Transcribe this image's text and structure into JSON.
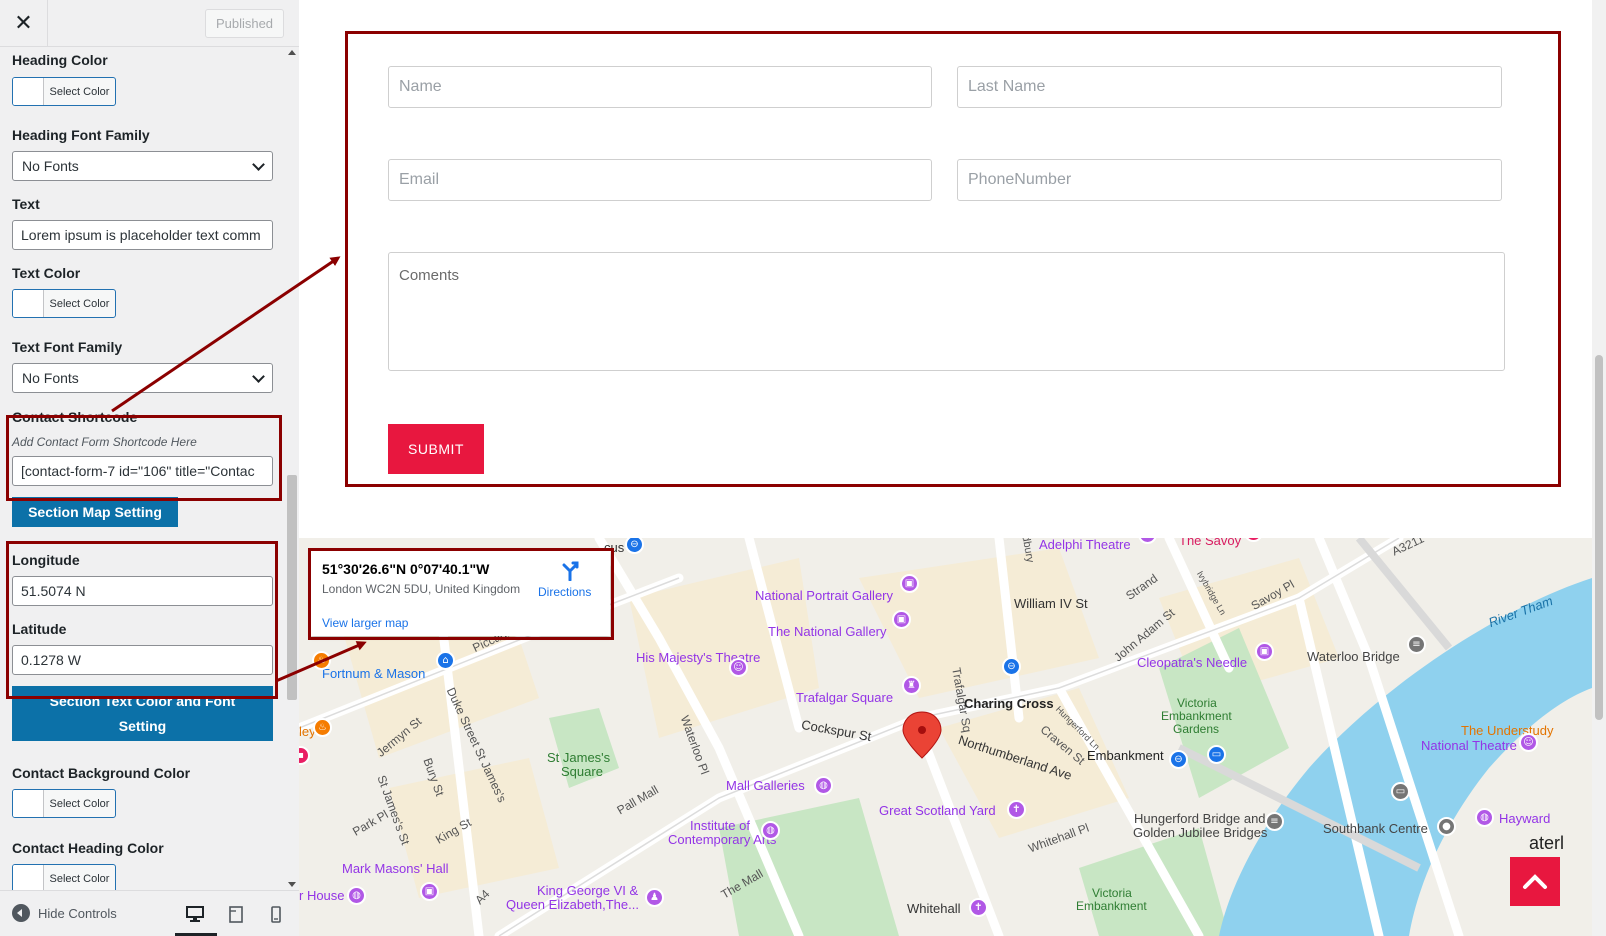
{
  "header": {
    "close_glyph": "✕",
    "published_label": "Published"
  },
  "sidebar": {
    "heading_color_label": "Heading Color",
    "heading_font_label": "Heading Font Family",
    "heading_font_value": "No Fonts",
    "text_label": "Text",
    "text_value": "Lorem ipsum is placeholder text comm",
    "text_color_label": "Text Color",
    "text_font_label": "Text Font Family",
    "text_font_value": "No Fonts",
    "contact_shortcode_label": "Contact Shortcode",
    "contact_shortcode_desc": "Add Contact Form Shortcode Here",
    "contact_shortcode_value": "[contact-form-7 id=\"106\" title=\"Contac",
    "map_section_button": "Section Map Setting",
    "longitude_label": "Longitude",
    "longitude_value": "51.5074 N",
    "latitude_label": "Latitude",
    "latitude_value": "0.1278 W",
    "text_color_font_button_line1": "Section Text Color and Font",
    "text_color_font_button_line2": "Setting",
    "contact_bg_label": "Contact Background Color",
    "contact_heading_color_label": "Contact Heading Color",
    "select_color_label": "Select Color"
  },
  "footer": {
    "hide_controls_label": "Hide Controls"
  },
  "form": {
    "name_placeholder": "Name",
    "lastname_placeholder": "Last Name",
    "email_placeholder": "Email",
    "phone_placeholder": "PhoneNumber",
    "comments_placeholder": "Coments",
    "submit_label": "SUBMIT"
  },
  "map": {
    "info_title": "51°30'26.6\"N 0°07'40.1\"W",
    "info_address": "London WC2N 5DU, United Kingdom",
    "info_directions": "Directions",
    "info_larger_map": "View larger map",
    "labels": {
      "cus": "cus",
      "adelphi": "Adelphi Theatre",
      "savoy": "The Savoy",
      "a3211": "A3211",
      "dbury": "dbury",
      "william": "William IV St",
      "strand": "Strand",
      "savoypl": "Savoy Pl",
      "ivybridge": "Ivybridge Ln",
      "river": "River Tham",
      "npg": "National Portrait Gallery",
      "tng": "The National Gallery",
      "johnadam": "John Adam St",
      "waterloo": "Waterloo Bridge",
      "piccadilly": "Piccadilly",
      "fortnum": "Fortnum & Mason",
      "hismajesty": "His Majesty's Theatre",
      "cleopatra": "Cleopatra's Needle",
      "trafalgar": "Trafalgar Square",
      "charing": "Charing Cross",
      "victoria_gardens_1": "Victoria",
      "victoria_gardens_2": "Embankment",
      "victoria_gardens_3": "Gardens",
      "understudy": "The Understudy",
      "ley": "ley",
      "jermyn": "Jermyn St",
      "dukestreet": "Duke Street St James's",
      "waterloopl": "Waterloo Pl",
      "cockspur": "Cockspur St",
      "trafalgarsq_road": "Trafalgar Sq",
      "hungerford_ln": "Hungerford Ln",
      "craven": "Craven St",
      "embankment": "Embankment",
      "nationaltheatre": "National Theatre",
      "stjames_1": "St James's",
      "stjames_2": "Square",
      "bury": "Bury St",
      "northumberland": "Northumberland Ave",
      "mallgalleries": "Mall Galleries",
      "pallmall": "Pall Mall",
      "stjamesst": "St James's St",
      "greatscotland": "Great Scotland Yard",
      "hungerford_1": "Hungerford Bridge and",
      "hungerford_2": "Golden Jubilee Bridges",
      "southbank": "Southbank Centre",
      "hayward": "Hayward",
      "parkpl": "Park Pl",
      "kingst": "King St",
      "ica_1": "Institute of",
      "ica_2": "Contemporary Arts",
      "whitehallpl": "Whitehall Pl",
      "waterl": "aterl",
      "masons": "Mark Masons' Hall",
      "themall": "The Mall",
      "kinggeorge_1": "King George VI &",
      "kinggeorge_2": "Queen Elizabeth,The...",
      "whitehall": "Whitehall",
      "victoria_emb_1": "Victoria",
      "victoria_emb_2": "Embankment",
      "house": "r House",
      "a4": "A4",
      "mp": "mp"
    }
  },
  "colors": {
    "accent_blue": "#0c71a8",
    "submit_red": "#e8173f",
    "annotation_red": "#8b0000",
    "map_water": "#8fd1ee",
    "map_park": "#c5e8c5"
  }
}
